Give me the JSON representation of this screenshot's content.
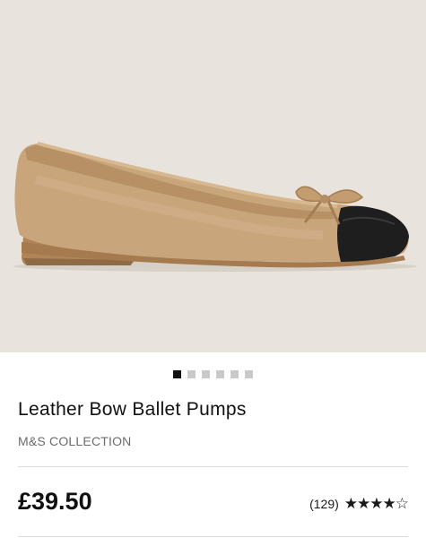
{
  "product": {
    "image_alt": "Leather Bow Ballet Pumps product image",
    "gallery": {
      "count": 6,
      "active_index": 0
    },
    "title": "Leather Bow Ballet Pumps",
    "brand": "M&S COLLECTION",
    "price": "£39.50",
    "rating": {
      "count_label": "(129)",
      "value": 4,
      "max": 5,
      "stars_text": "★★★★☆"
    }
  },
  "colors": {
    "hero_background": "#e8e3dd",
    "shoe_tan": "#c9a57c",
    "toe_cap": "#1e1e1e",
    "dot_active": "#111111",
    "dot_inactive": "#c9c9c9"
  }
}
